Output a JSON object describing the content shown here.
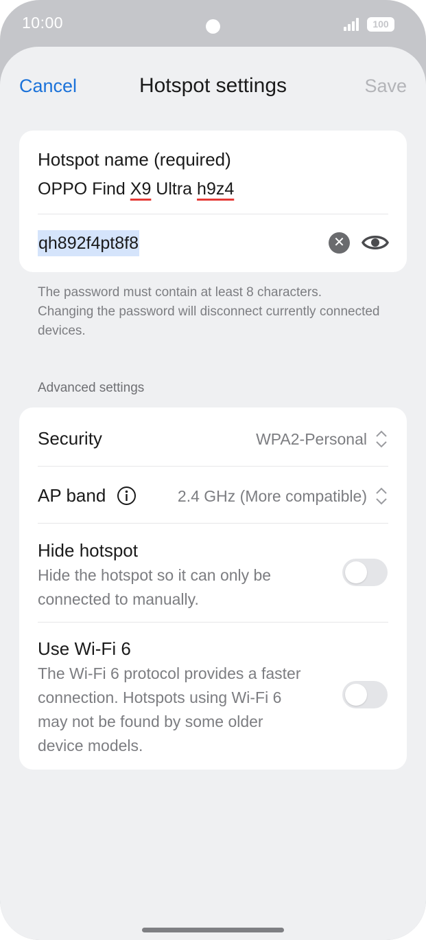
{
  "status_bar": {
    "time": "10:00",
    "battery": "100",
    "icons": [
      "signal-icon",
      "battery-icon"
    ]
  },
  "nav": {
    "cancel_label": "Cancel",
    "title": "Hotspot settings",
    "save_label": "Save"
  },
  "hotspot": {
    "name_label": "Hotspot name (required)",
    "name_parts": [
      "OPPO Find ",
      "X9",
      " Ultra ",
      "h9z4"
    ],
    "password_value": "qh892f4pt8f8",
    "icons": [
      "clear-icon",
      "eye-icon"
    ]
  },
  "hint": "The password must contain at least 8 characters. Changing the password will disconnect currently connected devices.",
  "advanced": {
    "header": "Advanced settings",
    "security_label": "Security",
    "security_value": "WPA2-Personal",
    "ap_band_label": "AP band",
    "ap_band_value": "2.4 GHz (More compatible)",
    "hide_label": "Hide hotspot",
    "hide_desc": "Hide the hotspot so it can only be connected to manually.",
    "hide_enabled": false,
    "wifi6_label": "Use Wi-Fi 6",
    "wifi6_desc": "The Wi-Fi 6 protocol provides a faster connection. Hotspots using Wi-Fi 6 may not be found by some older device models.",
    "wifi6_enabled": false
  },
  "colors": {
    "accent": "#1b72d9",
    "sheet_bg": "#eff0f2",
    "frame": "#c5c6ca",
    "spellcheck": "#e53935",
    "selection": "#d5e4fb"
  }
}
